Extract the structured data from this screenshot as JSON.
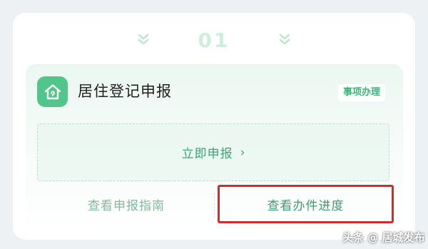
{
  "step": {
    "number": "01"
  },
  "service": {
    "title": "居住登记申报",
    "tag": "事项办理",
    "icon": "house-icon",
    "apply_label": "立即申报",
    "apply_arrow": "›"
  },
  "links": {
    "guide": "查看申报指南",
    "progress": "查看办件进度"
  },
  "watermark": "头条 @ 居城发布",
  "colors": {
    "accent": "#39a574",
    "icon_bg": "#52c58b",
    "highlight": "#c8302e"
  }
}
